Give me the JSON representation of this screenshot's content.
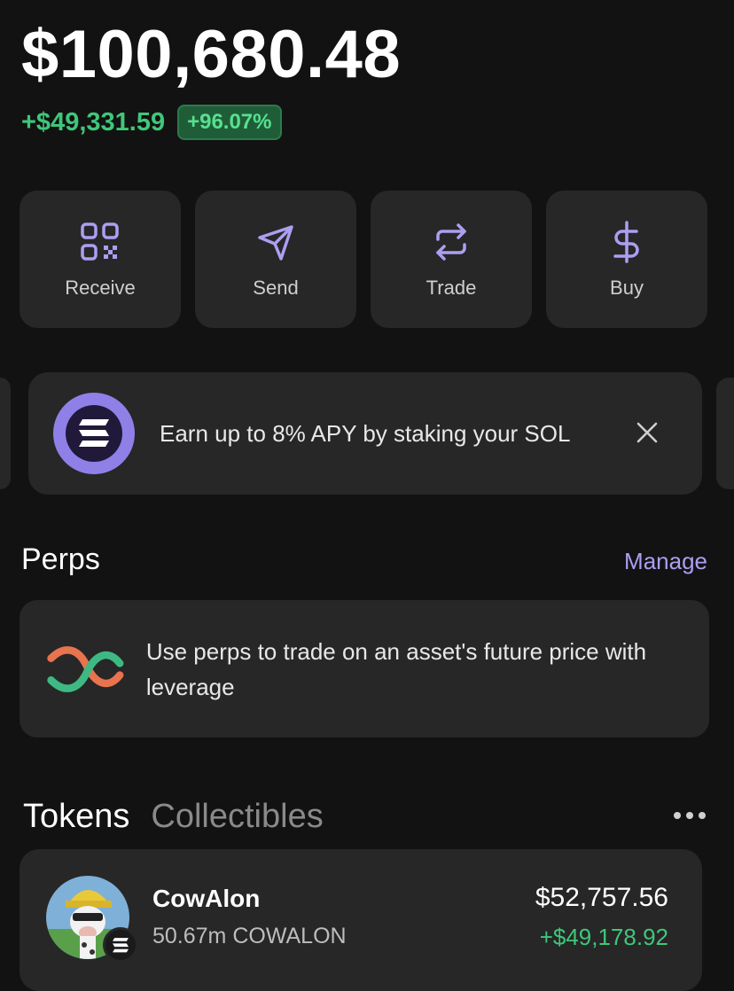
{
  "balance": "$100,680.48",
  "change": {
    "amount": "+$49,331.59",
    "percent": "+96.07%"
  },
  "actions": [
    {
      "label": "Receive",
      "icon": "qr-code-icon"
    },
    {
      "label": "Send",
      "icon": "send-arrow-icon"
    },
    {
      "label": "Trade",
      "icon": "swap-arrows-icon"
    },
    {
      "label": "Buy",
      "icon": "dollar-icon"
    }
  ],
  "promo": {
    "text": "Earn up to 8% APY by staking your SOL",
    "icon": "solana-logo-icon"
  },
  "perps": {
    "title": "Perps",
    "manage_label": "Manage",
    "description": "Use perps to trade on an asset's future price with leverage"
  },
  "tabs": {
    "tokens": "Tokens",
    "collectibles": "Collectibles"
  },
  "tokens": [
    {
      "name": "CowAlon",
      "amount": "50.67m COWALON",
      "value": "$52,757.56",
      "change": "+$49,178.92"
    }
  ],
  "colors": {
    "accent": "#ab9ff2",
    "positive": "#3fc77a",
    "card": "#272727",
    "background": "#121212"
  }
}
